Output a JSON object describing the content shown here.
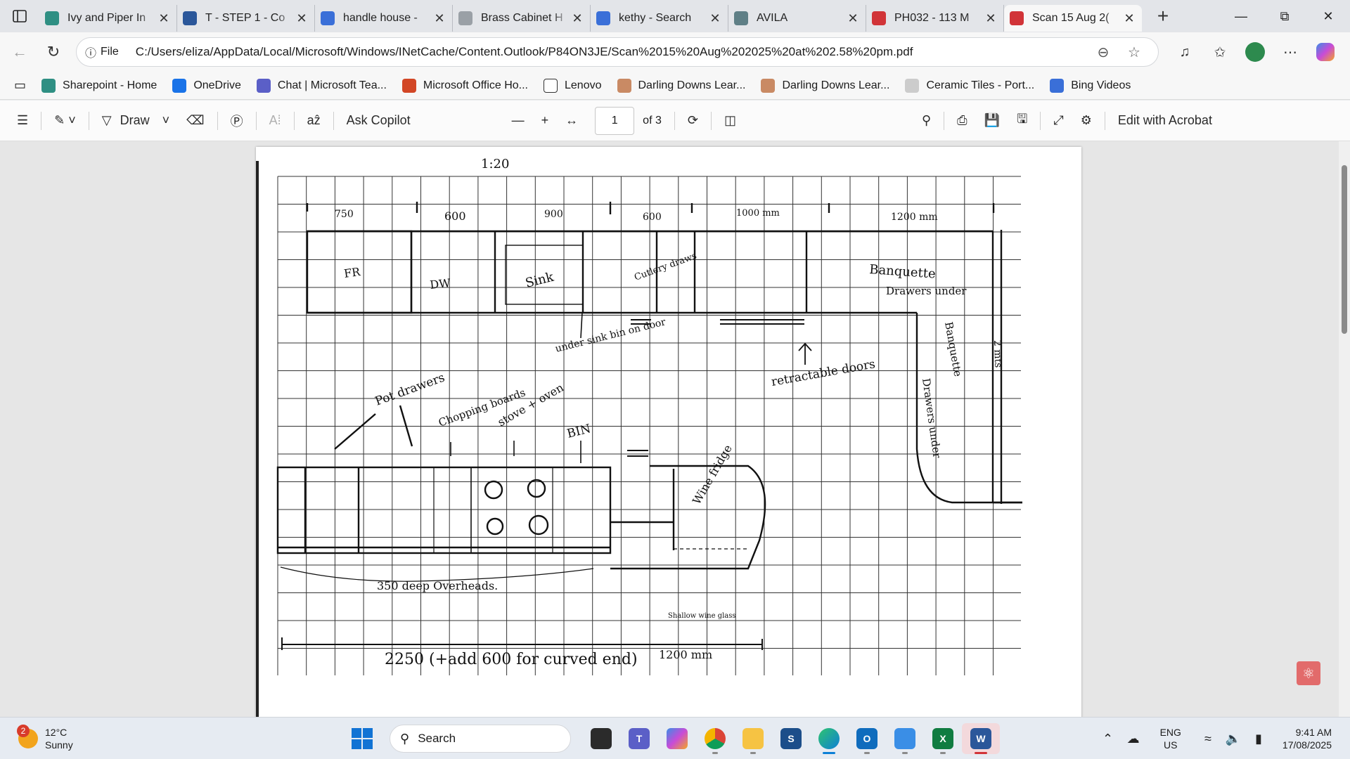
{
  "tabs": [
    {
      "title": "Ivy and Piper In",
      "icon": "sharepoint-icon",
      "color": "#2f8f83",
      "active": false
    },
    {
      "title": "T - STEP 1 - Co",
      "icon": "word-icon",
      "color": "#2b579a",
      "active": false
    },
    {
      "title": "handle house -",
      "icon": "search-icon",
      "color": "#3a6fd8",
      "active": false
    },
    {
      "title": "Brass Cabinet H",
      "icon": "page-icon",
      "color": "#9aa0a6",
      "active": false
    },
    {
      "title": "kethy - Search",
      "icon": "search-icon",
      "color": "#3a6fd8",
      "active": false
    },
    {
      "title": "AVILA",
      "icon": "avila-icon",
      "color": "#5f7f86",
      "active": false
    },
    {
      "title": "PH032 - 113 M",
      "icon": "pdf-icon",
      "color": "#d13438",
      "active": false
    },
    {
      "title": "Scan 15 Aug 2(",
      "icon": "pdf-icon",
      "color": "#d13438",
      "active": true
    }
  ],
  "address": {
    "file_label": "File",
    "url": "C:/Users/eliza/AppData/Local/Microsoft/Windows/INetCache/Content.Outlook/P84ON3JE/Scan%2015%20Aug%202025%20at%202.58%20pm.pdf"
  },
  "favorites": [
    {
      "label": "Sharepoint - Home",
      "color": "#2f8f83"
    },
    {
      "label": "OneDrive",
      "color": "#1a73e8"
    },
    {
      "label": "Chat | Microsoft Tea...",
      "color": "#5b5fc7"
    },
    {
      "label": "Microsoft Office Ho...",
      "color": "#d24726"
    },
    {
      "label": "Lenovo",
      "color": "#ffffff"
    },
    {
      "label": "Darling Downs Lear...",
      "color": "#c98a64"
    },
    {
      "label": "Darling Downs Lear...",
      "color": "#c98a64"
    },
    {
      "label": "Ceramic Tiles - Port...",
      "color": "#cccccc"
    },
    {
      "label": "Bing Videos",
      "color": "#3a6fd8"
    }
  ],
  "pdf_toolbar": {
    "draw_label": "Draw",
    "copilot_label": "Ask Copilot",
    "page_number": "1",
    "page_count": "of 3",
    "acrobat_label": "Edit with Acrobat"
  },
  "sketch": {
    "scale": "1:20",
    "top_dims": [
      "750",
      "600",
      "900",
      "600",
      "1000 mm",
      "1200 mm"
    ],
    "labels": {
      "fr": "FR",
      "dw": "DW",
      "sink": "Sink",
      "cutlery": "Cutlery draws",
      "banquette": "Banquette",
      "drawers_under": "Drawers under",
      "banquette_side": "Banquette",
      "drawers_under_side": "Drawers under",
      "mts": "2 mts",
      "under_sink": "under sink bin on door",
      "retractable": "retractable doors",
      "pot_drawers": "Pot drawers",
      "chopping": "Chopping boards",
      "stove": "stove + oven",
      "bin": "BIN",
      "wine": "Wine fridge",
      "overheads": "350 deep Overheads.",
      "shallow": "Shallow wine glass",
      "bottom_dim": "2250  (+add 600 for curved end)",
      "bottom_dim2": "1200 mm"
    }
  },
  "taskbar": {
    "weather_temp": "12°C",
    "weather_desc": "Sunny",
    "weather_badge": "2",
    "search_label": "Search",
    "lang_top": "ENG",
    "lang_bottom": "US",
    "time": "9:41 AM",
    "date": "17/08/2025"
  },
  "colors": {
    "accent": "#1173d4",
    "pdf_red": "#d13438"
  }
}
